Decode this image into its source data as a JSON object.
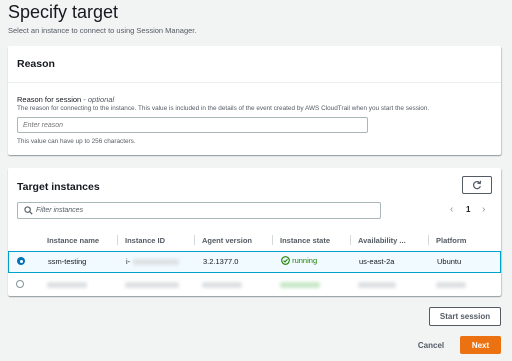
{
  "page": {
    "title": "Specify target",
    "subtitle": "Select an instance to connect to using Session Manager."
  },
  "reason": {
    "header": "Reason",
    "label": "Reason for session",
    "optional": "- optional",
    "description": "The reason for connecting to the instance. This value is included in the details of the event created by AWS CloudTrail when you start the session.",
    "placeholder": "Enter reason",
    "constraint": "This value can have up to 256 characters."
  },
  "targets": {
    "header": "Target instances",
    "filter_placeholder": "Filter instances",
    "page_number": "1",
    "columns": [
      "Instance name",
      "Instance ID",
      "Agent version",
      "Instance state",
      "Availability ...",
      "Platform"
    ],
    "rows": [
      {
        "selected": true,
        "instance_name": "ssm-testing",
        "instance_id": "i-",
        "agent_version": "3.2.1377.0",
        "state": "running",
        "availability_zone": "us-east-2a",
        "platform": "Ubuntu"
      },
      {
        "selected": false,
        "instance_name": "",
        "instance_id": "",
        "agent_version": "",
        "state": "",
        "availability_zone": "",
        "platform": ""
      }
    ]
  },
  "actions": {
    "start_session": "Start session",
    "cancel": "Cancel",
    "next": "Next"
  },
  "colors": {
    "primary": "#ec7211",
    "selected_row_bg": "#f1faff",
    "selected_row_border": "#00a1c9",
    "running": "#1d8102",
    "radio": "#0073bb"
  },
  "icons": {
    "refresh": "refresh-icon",
    "search": "search-icon",
    "running": "check-circle-icon",
    "prev": "chevron-left-icon",
    "next": "chevron-right-icon"
  }
}
